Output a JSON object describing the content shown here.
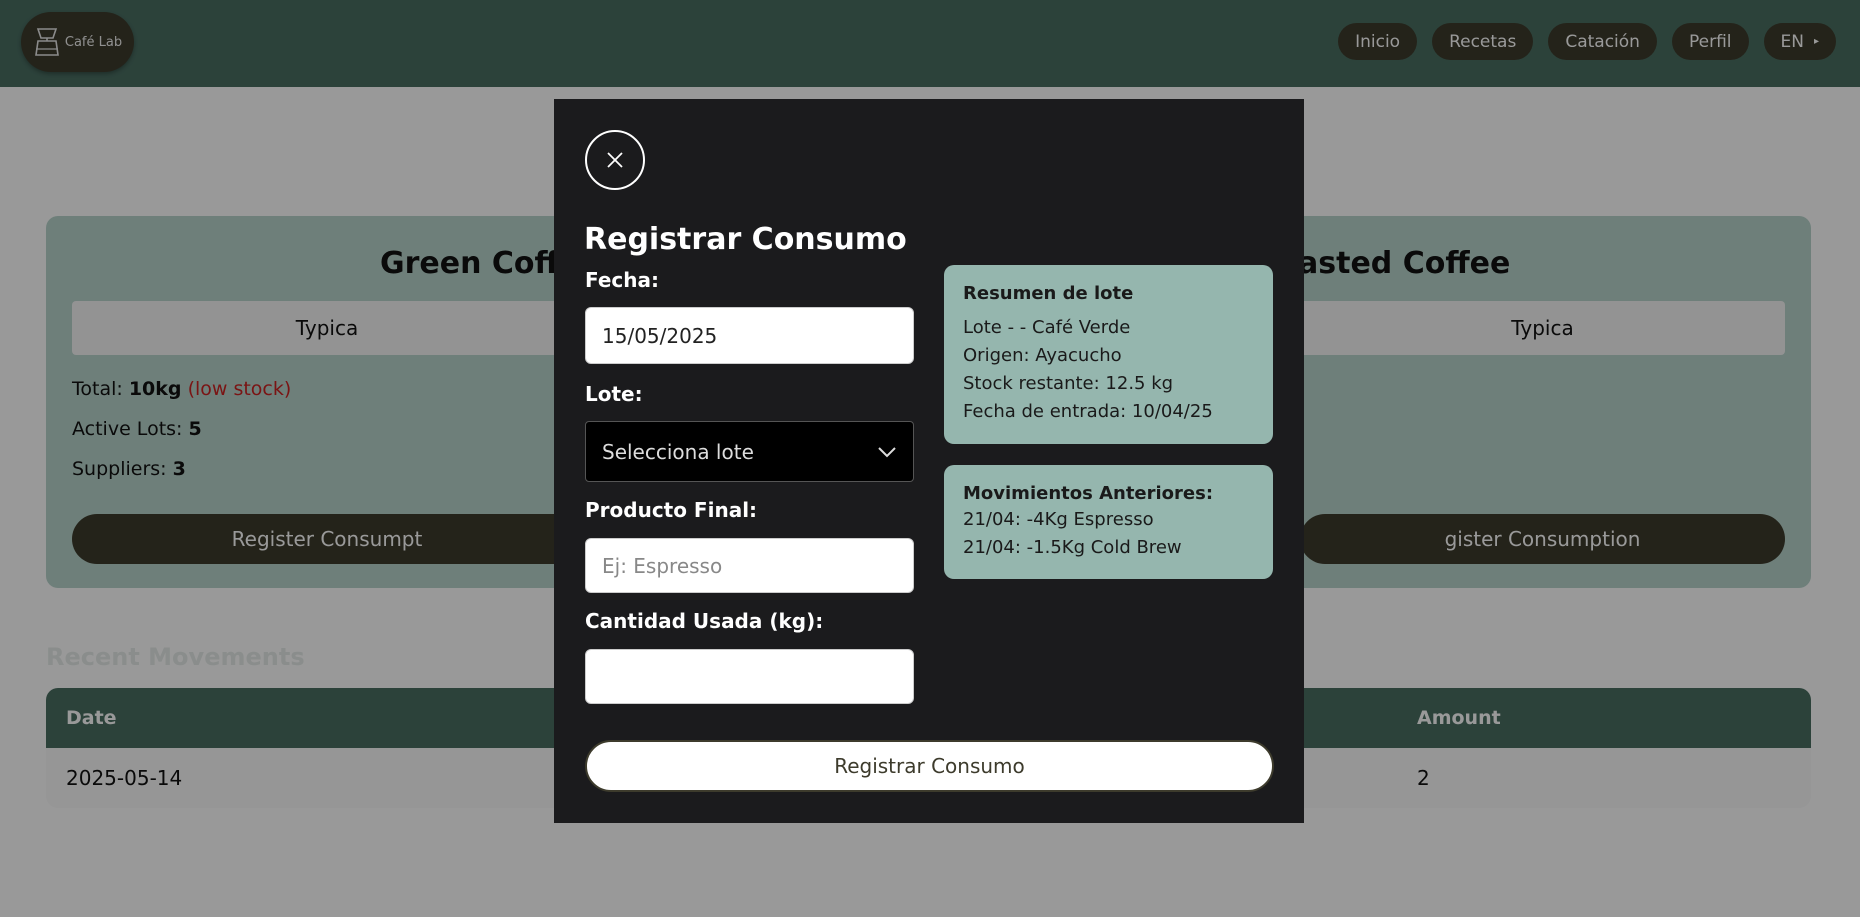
{
  "header": {
    "logo_text": "Café Lab",
    "nav": [
      {
        "label": "Inicio"
      },
      {
        "label": "Recetas"
      },
      {
        "label": "Catación"
      },
      {
        "label": "Perfil"
      }
    ],
    "language": {
      "label": "EN",
      "caret": "▸"
    }
  },
  "background": {
    "green_card": {
      "title": "Green Coffe",
      "variety": "Typica",
      "total_label": "Total:",
      "total_value": "10kg",
      "low_stock": "(low stock)",
      "active_lots_label": "Active Lots:",
      "active_lots_value": "5",
      "suppliers_label": "Suppliers:",
      "suppliers_value": "3",
      "button": "Register Consumpt"
    },
    "roasted_card": {
      "title": "asted Coffee",
      "variety": "Typica",
      "button": "gister Consumption"
    },
    "section_title": "Recent Movements",
    "table": {
      "headers": {
        "date": "Date",
        "amount": "Amount"
      },
      "rows": [
        {
          "date": "2025-05-14",
          "amount": "2"
        }
      ]
    }
  },
  "modal": {
    "title": "Registrar Consumo",
    "fecha_label": "Fecha:",
    "fecha_value": "15/05/2025",
    "lote_label": "Lote:",
    "lote_placeholder": "Selecciona lote",
    "producto_label": "Producto Final:",
    "producto_placeholder": "Ej: Espresso",
    "cantidad_label": "Cantidad Usada (kg):",
    "cantidad_value": "",
    "summary": {
      "title": "Resumen de lote",
      "lines": [
        "Lote - - Café Verde",
        "Origen: Ayacucho",
        "Stock restante: 12.5 kg",
        "Fecha de entrada: 10/04/25"
      ]
    },
    "movements": {
      "title": "Movimientos Anteriores:",
      "lines": [
        "21/04: -4Kg Espresso",
        "21/04: -1.5Kg Cold Brew"
      ]
    },
    "submit_label": "Registrar Consumo"
  }
}
